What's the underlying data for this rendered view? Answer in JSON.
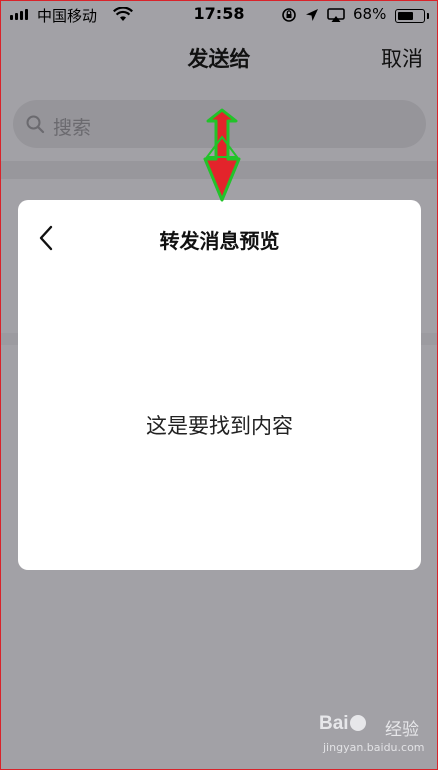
{
  "status_bar": {
    "carrier": "中国移动",
    "time": "17:58",
    "battery_percent": "68%",
    "battery_level": 0.68,
    "icons": [
      "signal-icon",
      "wifi-icon",
      "orientation-lock-icon",
      "location-icon",
      "airplay-icon",
      "battery-icon"
    ]
  },
  "nav": {
    "title": "发送给",
    "cancel_label": "取消"
  },
  "search": {
    "placeholder": "搜索",
    "icon": "search-icon"
  },
  "dialog": {
    "title": "转发消息预览",
    "back_icon": "chevron-left-icon",
    "body_text": "这是要找到内容"
  },
  "annotation": {
    "icon": "down-arrow-icon",
    "fill_color": "#e3242b",
    "outline_color": "#22c32a"
  },
  "watermark": {
    "logo_left": "Bai",
    "logo_right": "经验",
    "url": "jingyan.baidu.com"
  },
  "colors": {
    "overlay_background": "#a2a1a6",
    "dialog_background": "#ffffff"
  }
}
